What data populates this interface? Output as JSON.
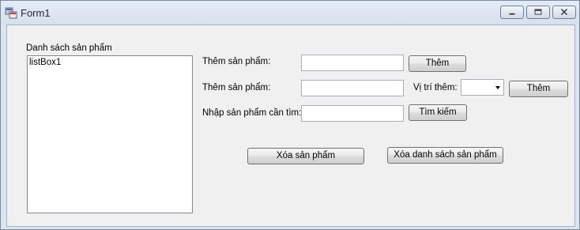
{
  "window": {
    "title": "Form1"
  },
  "list": {
    "label": "Danh sách sản phẩm",
    "items": [
      "listBox1"
    ]
  },
  "form": {
    "add_label_1": "Thêm sản phẩm:",
    "add_button_1": "Thêm",
    "add_label_2": "Thêm sản phẩm:",
    "position_label": "Vị trí thêm:",
    "add_button_2": "Thêm",
    "search_label": "Nhập sản phẩm cần tìm:",
    "search_button": "Tìm kiếm",
    "delete_button": "Xóa sản phẩm",
    "clear_button": "Xóa danh sách sản phẩm",
    "add_input_1_value": "",
    "add_input_2_value": "",
    "search_input_value": "",
    "position_value": ""
  }
}
